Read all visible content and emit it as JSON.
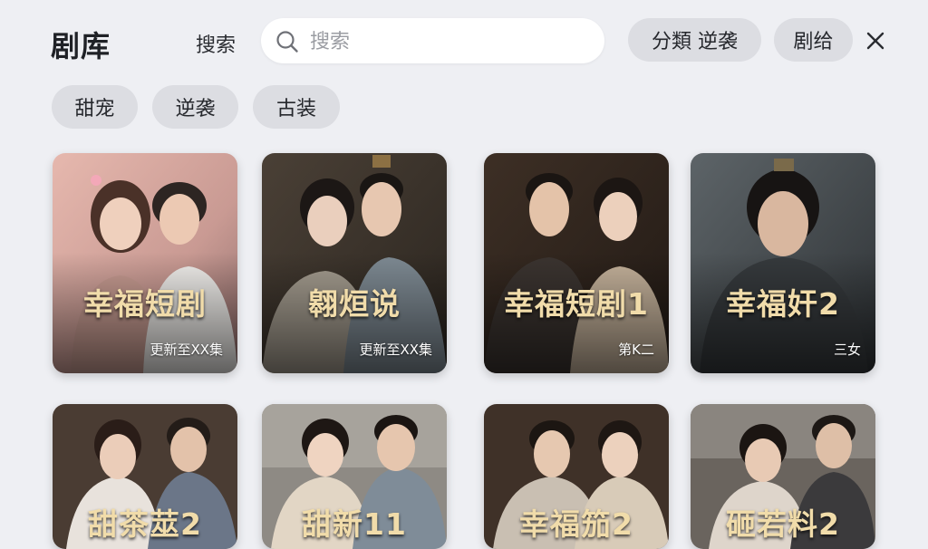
{
  "header": {
    "title": "剧库",
    "search_label": "搜索",
    "search_placeholder": "搜索",
    "filters": [
      "分類 逆袭",
      "剧给"
    ]
  },
  "tags": [
    "甜宠",
    "逆袭",
    "古装"
  ],
  "dramas": [
    {
      "title": "幸福短剧",
      "subtitle": "更新至XX集"
    },
    {
      "title": "翱烜说",
      "subtitle": "更新至XX集"
    },
    {
      "title": "幸福短剧1",
      "subtitle": "第K二"
    },
    {
      "title": "幸福奸2",
      "subtitle": "三女"
    },
    {
      "title": "甜茶莁2",
      "subtitle": ""
    },
    {
      "title": "甜新11",
      "subtitle": ""
    },
    {
      "title": "幸福笳2",
      "subtitle": ""
    },
    {
      "title": "砸若料2",
      "subtitle": ""
    }
  ],
  "colors": {
    "background": "#eeeff3",
    "pill": "#dcdde2",
    "title_gold": "#f1dcaa"
  }
}
